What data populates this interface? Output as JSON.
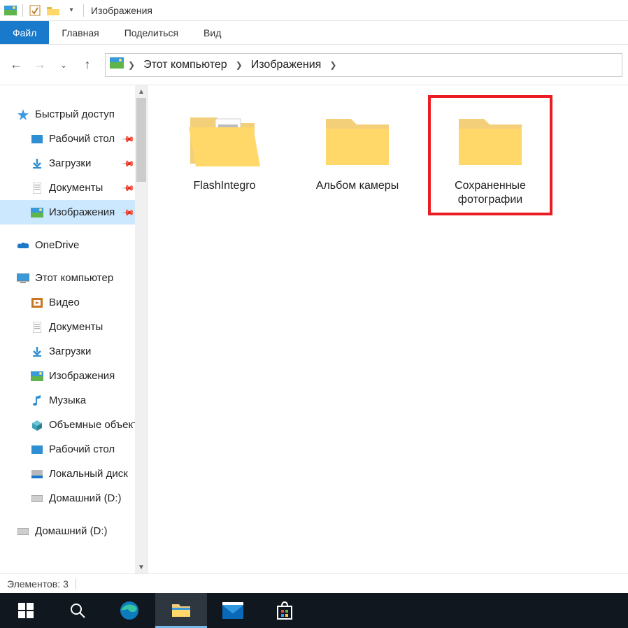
{
  "window": {
    "title": "Изображения"
  },
  "ribbon": {
    "file": "Файл",
    "home": "Главная",
    "share": "Поделиться",
    "view": "Вид"
  },
  "breadcrumbs": {
    "computer": "Этот компьютер",
    "pictures": "Изображения"
  },
  "sidebar": {
    "quick_access": "Быстрый доступ",
    "desktop": "Рабочий стол",
    "downloads": "Загрузки",
    "documents": "Документы",
    "pictures": "Изображения",
    "onedrive": "OneDrive",
    "this_pc": "Этот компьютер",
    "videos": "Видео",
    "documents2": "Документы",
    "downloads2": "Загрузки",
    "pictures2": "Изображения",
    "music": "Музыка",
    "objects3d": "Объемные объекты",
    "desktop2": "Рабочий стол",
    "local_disk": "Локальный диск",
    "home_d": "Домашний (D:)",
    "home_d2": "Домашний (D:)"
  },
  "folders": {
    "items": [
      {
        "label": "FlashIntegro",
        "highlighted": false
      },
      {
        "label": "Альбом камеры",
        "highlighted": false
      },
      {
        "label": "Сохраненные фотографии",
        "highlighted": true
      }
    ]
  },
  "status": {
    "elements_label": "Элементов:",
    "count": "3"
  }
}
